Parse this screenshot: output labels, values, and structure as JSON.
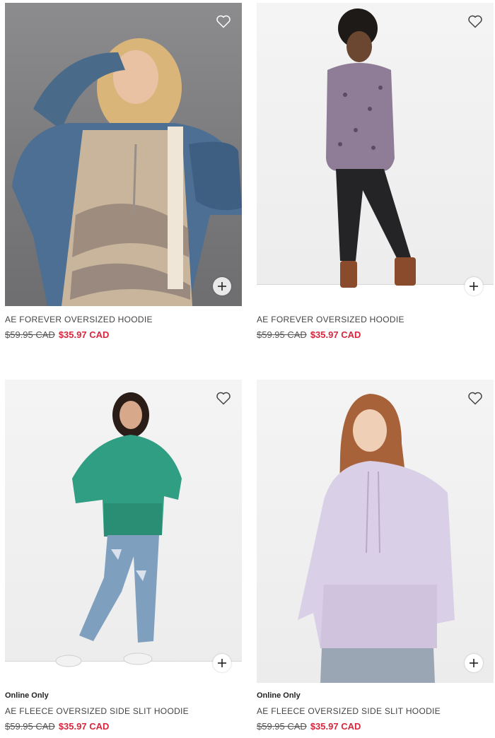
{
  "products": [
    {
      "badge": "",
      "name": "AE FOREVER OVERSIZED HOODIE",
      "old_price": "$59.95 CAD",
      "sale_price": "$35.97 CAD"
    },
    {
      "badge": "",
      "name": "AE FOREVER OVERSIZED HOODIE",
      "old_price": "$59.95 CAD",
      "sale_price": "$35.97 CAD"
    },
    {
      "badge": "Online Only",
      "name": "AE FLEECE OVERSIZED SIDE SLIT HOODIE",
      "old_price": "$59.95 CAD",
      "sale_price": "$35.97 CAD"
    },
    {
      "badge": "Online Only",
      "name": "AE FLEECE OVERSIZED SIDE SLIT HOODIE",
      "old_price": "$59.95 CAD",
      "sale_price": "$35.97 CAD"
    }
  ],
  "icons": {
    "favorite": "heart-outline-icon",
    "quick_add": "plus-icon"
  },
  "colors": {
    "sale_price": "#d7263d",
    "text": "#444444"
  }
}
